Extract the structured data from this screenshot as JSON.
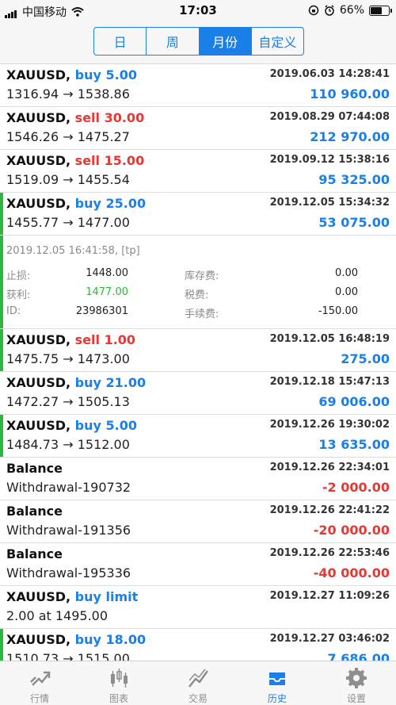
{
  "status": {
    "carrier": "中国移动",
    "time": "17:03",
    "battery": "66%",
    "battery_fraction": 0.66
  },
  "periods": [
    {
      "label": "日",
      "active": false
    },
    {
      "label": "周",
      "active": false
    },
    {
      "label": "月份",
      "active": true
    },
    {
      "label": "自定义",
      "active": false
    }
  ],
  "deals": [
    {
      "symbol": "XAUUSD,",
      "side": "buy 5.00",
      "dir": "buy",
      "time": "2019.06.03 14:28:41",
      "prices": "1316.94 → 1538.86",
      "amount": "110 960.00",
      "sign": "pos",
      "bar": false
    },
    {
      "symbol": "XAUUSD,",
      "side": "sell 30.00",
      "dir": "sell",
      "time": "2019.08.29 07:44:08",
      "prices": "1546.26 → 1475.27",
      "amount": "212 970.00",
      "sign": "pos",
      "bar": false
    },
    {
      "symbol": "XAUUSD,",
      "side": "sell 15.00",
      "dir": "sell",
      "time": "2019.09.12 15:38:16",
      "prices": "1519.09 → 1455.54",
      "amount": "95 325.00",
      "sign": "pos",
      "bar": false
    },
    {
      "symbol": "XAUUSD,",
      "side": "buy 25.00",
      "dir": "buy",
      "time": "2019.12.05 15:34:32",
      "prices": "1455.77 → 1477.00",
      "amount": "53 075.00",
      "sign": "pos",
      "bar": true
    },
    {
      "symbol": "XAUUSD,",
      "side": "sell 1.00",
      "dir": "sell",
      "time": "2019.12.05 16:48:19",
      "prices": "1475.75 → 1473.00",
      "amount": "275.00",
      "sign": "pos",
      "bar": true
    },
    {
      "symbol": "XAUUSD,",
      "side": "buy 21.00",
      "dir": "buy",
      "time": "2019.12.18 15:47:13",
      "prices": "1472.27 → 1505.13",
      "amount": "69 006.00",
      "sign": "pos",
      "bar": false
    },
    {
      "symbol": "XAUUSD,",
      "side": "buy 5.00",
      "dir": "buy",
      "time": "2019.12.26 19:30:02",
      "prices": "1484.73 → 1512.00",
      "amount": "13 635.00",
      "sign": "pos",
      "bar": true
    },
    {
      "symbol": "Balance",
      "side": "",
      "dir": "buy",
      "time": "2019.12.26 22:34:01",
      "prices": "Withdrawal-190732",
      "amount": "-2 000.00",
      "sign": "neg",
      "bar": false
    },
    {
      "symbol": "Balance",
      "side": "",
      "dir": "buy",
      "time": "2019.12.26 22:41:22",
      "prices": "Withdrawal-191356",
      "amount": "-20 000.00",
      "sign": "neg",
      "bar": false
    },
    {
      "symbol": "Balance",
      "side": "",
      "dir": "buy",
      "time": "2019.12.26 22:53:46",
      "prices": "Withdrawal-195336",
      "amount": "-40 000.00",
      "sign": "neg",
      "bar": false
    },
    {
      "symbol": "XAUUSD,",
      "side": "buy limit",
      "dir": "buy",
      "time": "2019.12.27 11:09:26",
      "prices": "2.00 at 1495.00",
      "amount": "",
      "sign": "pos",
      "bar": false
    },
    {
      "symbol": "XAUUSD,",
      "side": "buy 18.00",
      "dir": "buy",
      "time": "2019.12.27 03:46:02",
      "prices": "1510.73 → 1515.00",
      "amount": "7 686.00",
      "sign": "pos",
      "bar": true
    }
  ],
  "detail": {
    "line": "2019.12.05 16:41:58, [tp]",
    "stop_loss_label": "止损:",
    "stop_loss": "1448.00",
    "swap_label": "库存费:",
    "swap": "0.00",
    "take_profit_label": "获利:",
    "take_profit": "1477.00",
    "tax_label": "税费:",
    "tax": "0.00",
    "id_label": "ID:",
    "id": "23986301",
    "fee_label": "手续费:",
    "fee": "-150.00"
  },
  "tabs": [
    {
      "label": "行情",
      "icon": "quotes-icon",
      "active": false
    },
    {
      "label": "图表",
      "icon": "candlestick-chart-icon",
      "active": false
    },
    {
      "label": "交易",
      "icon": "trade-icon",
      "active": false
    },
    {
      "label": "历史",
      "icon": "history-inbox-icon",
      "active": true
    },
    {
      "label": "设置",
      "icon": "gear-icon",
      "active": false
    }
  ]
}
